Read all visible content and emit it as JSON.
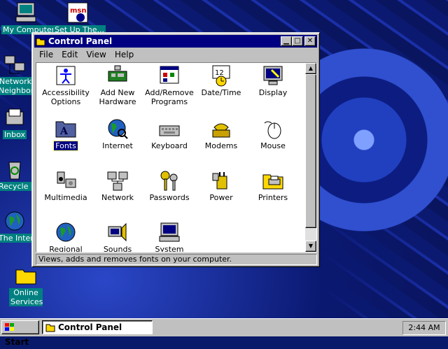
{
  "desktop": {
    "icons": [
      {
        "label": "My Computer",
        "icon": "my-computer-icon"
      },
      {
        "label": "Set Up The...",
        "icon": "msn-icon"
      },
      {
        "label": "Network Neighborhood",
        "icon": "network-neighborhood-icon"
      },
      {
        "label": "Inbox",
        "icon": "inbox-icon"
      },
      {
        "label": "Recycle Bin",
        "icon": "recycle-bin-icon"
      },
      {
        "label": "The Internet",
        "icon": "internet-globe-icon"
      },
      {
        "label": "Online Services",
        "icon": "folder-icon"
      }
    ]
  },
  "window": {
    "title": "Control Panel",
    "menu": [
      "File",
      "Edit",
      "View",
      "Help"
    ],
    "items": [
      {
        "label": "Accessibility Options",
        "icon": "accessibility-icon"
      },
      {
        "label": "Add New Hardware",
        "icon": "hardware-icon"
      },
      {
        "label": "Add/Remove Programs",
        "icon": "programs-icon"
      },
      {
        "label": "Date/Time",
        "icon": "calendar-clock-icon"
      },
      {
        "label": "Display",
        "icon": "display-icon"
      },
      {
        "label": "Fonts",
        "icon": "fonts-folder-icon"
      },
      {
        "label": "Internet",
        "icon": "globe-icon"
      },
      {
        "label": "Keyboard",
        "icon": "keyboard-icon"
      },
      {
        "label": "Modems",
        "icon": "modem-phone-icon"
      },
      {
        "label": "Mouse",
        "icon": "mouse-icon"
      },
      {
        "label": "Multimedia",
        "icon": "multimedia-icon"
      },
      {
        "label": "Network",
        "icon": "network-icon"
      },
      {
        "label": "Passwords",
        "icon": "keys-icon"
      },
      {
        "label": "Power",
        "icon": "power-plug-icon"
      },
      {
        "label": "Printers",
        "icon": "printer-folder-icon"
      },
      {
        "label": "Regional",
        "icon": "regional-globe-icon"
      },
      {
        "label": "Sounds",
        "icon": "speaker-icon"
      },
      {
        "label": "System",
        "icon": "system-computer-icon"
      }
    ],
    "selected": "Fonts",
    "status": "Views, adds and removes fonts on your computer."
  },
  "taskbar": {
    "start_label": "Start",
    "task_label": "Control Panel",
    "clock": "2:44 AM"
  },
  "colors": {
    "titlebar": "#000080",
    "face": "#c0c0c0",
    "desktop_label_bg": "#008080"
  }
}
